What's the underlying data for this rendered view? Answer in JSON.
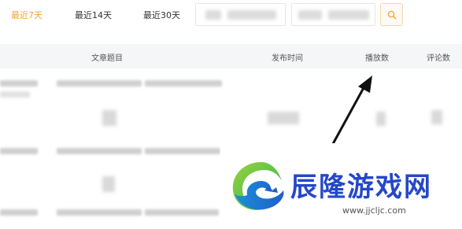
{
  "filters": {
    "tabs": [
      {
        "label": "最近7天",
        "active": true
      },
      {
        "label": "最近14天",
        "active": false
      },
      {
        "label": "最近30天",
        "active": false
      }
    ],
    "active_color": "#f2a33a",
    "search_icon": "search-icon"
  },
  "table": {
    "columns": [
      "文章题目",
      "发布时间",
      "播放数",
      "评论数"
    ]
  },
  "annotation": {
    "arrow_target": "播放数"
  },
  "watermark": {
    "title": "辰隆游戏网",
    "url": "www.jjcljc.com",
    "color": "#2547c8"
  }
}
